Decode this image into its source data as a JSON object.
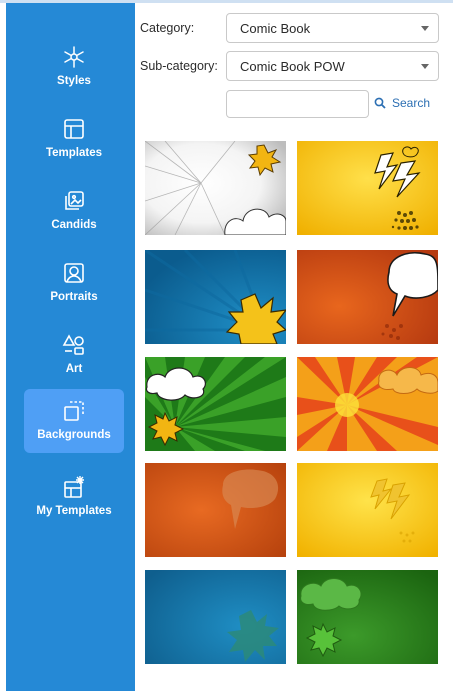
{
  "sidebar": {
    "items": [
      {
        "label": "Styles",
        "icon": "styles-icon",
        "active": false
      },
      {
        "label": "Templates",
        "icon": "templates-icon",
        "active": false
      },
      {
        "label": "Candids",
        "icon": "candids-icon",
        "active": false
      },
      {
        "label": "Portraits",
        "icon": "portraits-icon",
        "active": false
      },
      {
        "label": "Art",
        "icon": "art-icon",
        "active": false
      },
      {
        "label": "Backgrounds",
        "icon": "backgrounds-icon",
        "active": true
      },
      {
        "label": "My Templates",
        "icon": "my-templates-icon",
        "active": false
      }
    ]
  },
  "filters": {
    "category_label": "Category:",
    "category_value": "Comic Book",
    "subcategory_label": "Sub-category:",
    "subcategory_value": "Comic Book POW",
    "search_value": "",
    "search_button": "Search"
  },
  "backgrounds": [
    {
      "theme": "white burst with yellow star and cloud"
    },
    {
      "theme": "yellow with lightning bolts"
    },
    {
      "theme": "blue rays with yellow explosion"
    },
    {
      "theme": "orange with speech bubble"
    },
    {
      "theme": "green rays with clouds and star"
    },
    {
      "theme": "orange sunburst with cloud"
    },
    {
      "theme": "orange with speech bubble"
    },
    {
      "theme": "yellow with lightning bolts"
    },
    {
      "theme": "blue with green explosion"
    },
    {
      "theme": "green with cloud and explosion"
    }
  ],
  "colors": {
    "sidebar": "#2589d6",
    "active_item": "#4f9ff5",
    "search_link": "#2c6fb3"
  }
}
